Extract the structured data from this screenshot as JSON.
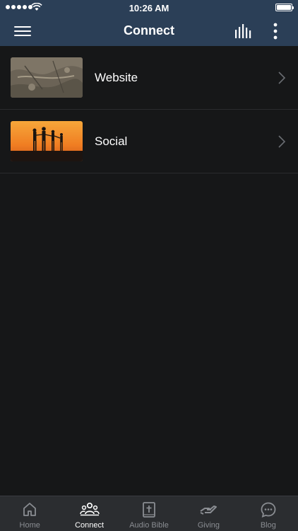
{
  "status_bar": {
    "time": "10:26 AM",
    "battery_level": 1.0
  },
  "nav": {
    "title": "Connect",
    "icons": [
      "menu-icon",
      "equalizer-icon",
      "more-vertical-icon"
    ]
  },
  "list": {
    "items": [
      {
        "label": "Website",
        "thumbnail": "aerial-landscape-image"
      },
      {
        "label": "Social",
        "thumbnail": "sunset-family-silhouette-image"
      }
    ]
  },
  "tabs": [
    {
      "label": "Home",
      "icon": "home-icon",
      "active": false
    },
    {
      "label": "Connect",
      "icon": "people-group-icon",
      "active": true
    },
    {
      "label": "Audio Bible",
      "icon": "bible-icon",
      "active": false
    },
    {
      "label": "Giving",
      "icon": "giving-hand-icon",
      "active": false
    },
    {
      "label": "Blog",
      "icon": "chat-bubble-icon",
      "active": false
    }
  ],
  "colors": {
    "bar": "#2b3f57",
    "background": "#161718",
    "tab_bar": "#2b2d30",
    "inactive": "#8a8d92"
  }
}
